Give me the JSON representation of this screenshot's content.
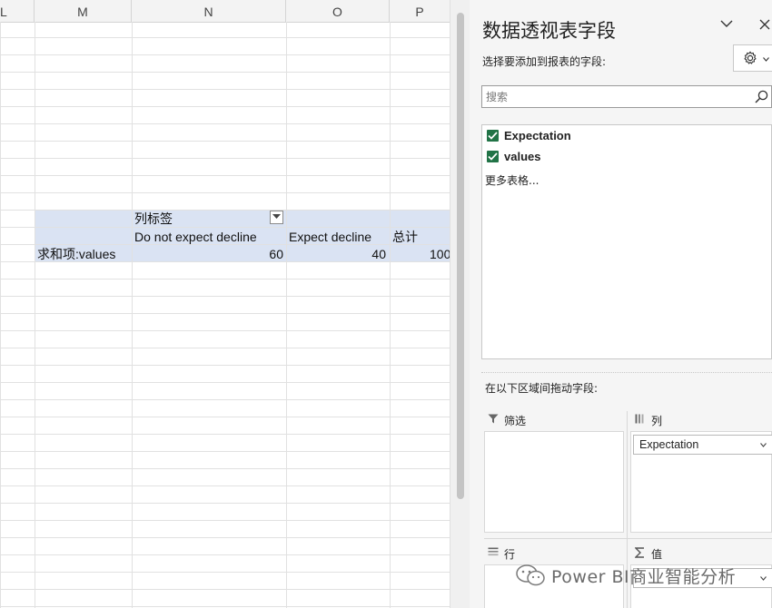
{
  "sheet": {
    "columns": [
      "L",
      "M",
      "N",
      "O",
      "P"
    ],
    "pivot": {
      "col_labels_header": "列标签",
      "col_header_1": "Do not expect decline",
      "col_header_2": "Expect decline",
      "col_header_total": "总计",
      "row_label": "求和项:values",
      "value_1": "60",
      "value_2": "40",
      "value_total": "100"
    }
  },
  "pane": {
    "title": "数据透视表字段",
    "subtitle": "选择要添加到报表的字段:",
    "search_placeholder": "搜索",
    "fields": [
      {
        "label": "Expectation",
        "checked": true
      },
      {
        "label": "values",
        "checked": true
      }
    ],
    "more_tables": "更多表格...",
    "drag_hint": "在以下区域间拖动字段:",
    "zones": {
      "filter": "筛选",
      "columns": "列",
      "columns_item": "Expectation",
      "rows": "行",
      "values": "值"
    },
    "icons": {
      "chevron": "chevron-down-icon",
      "close": "close-icon",
      "gear": "gear-icon",
      "search": "search-icon",
      "filter": "filter-icon",
      "columns": "columns-icon",
      "rows": "rows-icon",
      "values": "sigma-icon"
    },
    "colors": {
      "checkbox": "#217346",
      "pivot_band": "#dae3f3"
    }
  },
  "watermark": {
    "text": "Power BI商业智能分析"
  }
}
